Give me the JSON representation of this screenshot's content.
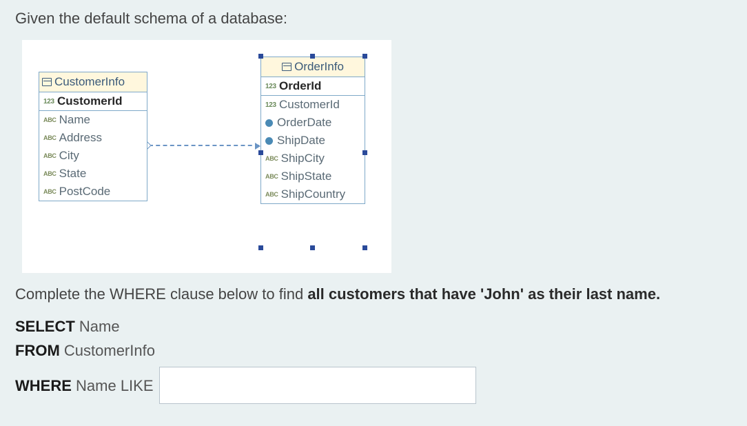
{
  "intro_text": "Given the default schema of a database:",
  "tables": {
    "customer": {
      "title": "CustomerInfo",
      "pk": {
        "badge": "123",
        "name": "CustomerId"
      },
      "cols": [
        {
          "badge": "ABC",
          "name": "Name"
        },
        {
          "badge": "ABC",
          "name": "Address"
        },
        {
          "badge": "ABC",
          "name": "City"
        },
        {
          "badge": "ABC",
          "name": "State"
        },
        {
          "badge": "ABC",
          "name": "PostCode"
        }
      ]
    },
    "order": {
      "title": "OrderInfo",
      "pk": {
        "badge": "123",
        "name": "OrderId"
      },
      "cols": [
        {
          "badge": "123",
          "name": "CustomerId",
          "kind": "num"
        },
        {
          "badge": "",
          "name": "OrderDate",
          "kind": "date"
        },
        {
          "badge": "",
          "name": "ShipDate",
          "kind": "date"
        },
        {
          "badge": "ABC",
          "name": "ShipCity",
          "kind": "txt"
        },
        {
          "badge": "ABC",
          "name": "ShipState",
          "kind": "txt"
        },
        {
          "badge": "ABC",
          "name": "ShipCountry",
          "kind": "txt"
        }
      ]
    }
  },
  "question": {
    "lead": "Complete the WHERE clause below to find ",
    "bold": "all customers that have 'John' as their last name."
  },
  "sql": {
    "select_kw": "SELECT",
    "select_col": "Name",
    "from_kw": "FROM",
    "from_tbl": "CustomerInfo",
    "where_kw": "WHERE",
    "where_pred": "Name LIKE"
  },
  "answer_value": ""
}
